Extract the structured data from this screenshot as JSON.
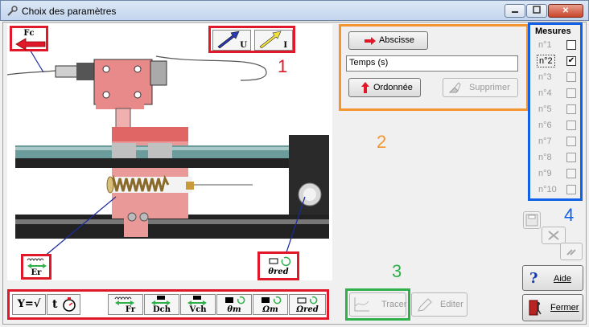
{
  "window": {
    "title": "Choix des paramètres",
    "min_icon": "minimize-icon",
    "max_icon": "maximize-icon",
    "close_glyph": "✕"
  },
  "illustration": {
    "fc_label": "Fc",
    "u_label": "U",
    "i_label": "I",
    "er_label": "Er",
    "thetared_label": "θred",
    "num1": "1",
    "num2": "2",
    "num3": "3",
    "num4": "4"
  },
  "param_panel": {
    "abscisse_label": "Abscisse",
    "field_value": "Temps (s)",
    "ordonnee_label": "Ordonnée",
    "supprimer_label": "Supprimer"
  },
  "mesures": {
    "title": "Mesures",
    "items": [
      {
        "label": "n°1",
        "checked": false,
        "enabled": true
      },
      {
        "label": "n°2",
        "checked": true,
        "enabled": true
      },
      {
        "label": "n°3",
        "checked": false,
        "enabled": false
      },
      {
        "label": "n°4",
        "checked": false,
        "enabled": false
      },
      {
        "label": "n°5",
        "checked": false,
        "enabled": false
      },
      {
        "label": "n°6",
        "checked": false,
        "enabled": false
      },
      {
        "label": "n°7",
        "checked": false,
        "enabled": false
      },
      {
        "label": "n°8",
        "checked": false,
        "enabled": false
      },
      {
        "label": "n°9",
        "checked": false,
        "enabled": false
      },
      {
        "label": "n°10",
        "checked": false,
        "enabled": false
      }
    ]
  },
  "bottom_toolbar": {
    "formula_label": "Y=√",
    "timer_label": "t",
    "fr_label": "Fr",
    "dch_label": "Dch",
    "vch_label": "Vch",
    "thetam_label": "θm",
    "omegam_label": "Ωm",
    "omegared_label": "Ωred"
  },
  "actions": {
    "tracer_label": "Tracer",
    "editer_label": "Editer",
    "aide_label": "Aide",
    "fermer_label": "Fermer"
  },
  "colors": {
    "red_frame": "#e0182a",
    "orange_frame": "#f39530",
    "blue_frame": "#1060e8",
    "green_frame": "#2fb04a"
  }
}
